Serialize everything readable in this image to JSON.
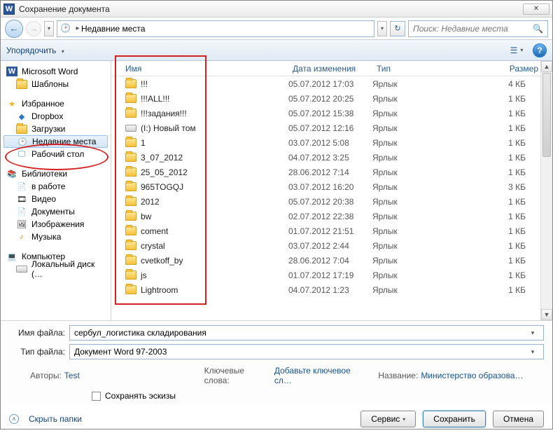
{
  "title": "Сохранение документа",
  "breadcrumb": {
    "current": "Недавние места"
  },
  "search_placeholder": "Поиск: Недавние места",
  "toolbar": {
    "organize": "Упорядочить"
  },
  "sidebar": {
    "word": "Microsoft Word",
    "templates": "Шаблоны",
    "favorites": "Избранное",
    "dropbox": "Dropbox",
    "downloads": "Загрузки",
    "recent": "Недавние места",
    "desktop": "Рабочий стол",
    "libraries": "Библиотеки",
    "inwork": "в работе",
    "video": "Видео",
    "documents": "Документы",
    "pictures": "Изображения",
    "music": "Музыка",
    "computer": "Компьютер",
    "localdisk": "Локальный диск (…"
  },
  "columns": {
    "name": "Имя",
    "date": "Дата изменения",
    "type": "Тип",
    "size": "Размер"
  },
  "files": [
    {
      "name": "!!!",
      "date": "05.07.2012 17:03",
      "type": "Ярлык",
      "size": "4 КБ",
      "kind": "f"
    },
    {
      "name": "!!!ALL!!!",
      "date": "05.07.2012 20:25",
      "type": "Ярлык",
      "size": "1 КБ",
      "kind": "f"
    },
    {
      "name": "!!!задания!!!",
      "date": "05.07.2012 15:38",
      "type": "Ярлык",
      "size": "1 КБ",
      "kind": "f"
    },
    {
      "name": "(I:) Новый том",
      "date": "05.07.2012 12:16",
      "type": "Ярлык",
      "size": "1 КБ",
      "kind": "d"
    },
    {
      "name": "1",
      "date": "03.07.2012 5:08",
      "type": "Ярлык",
      "size": "1 КБ",
      "kind": "f"
    },
    {
      "name": "3_07_2012",
      "date": "04.07.2012 3:25",
      "type": "Ярлык",
      "size": "1 КБ",
      "kind": "f"
    },
    {
      "name": "25_05_2012",
      "date": "28.06.2012 7:14",
      "type": "Ярлык",
      "size": "1 КБ",
      "kind": "f"
    },
    {
      "name": "965TOGQJ",
      "date": "03.07.2012 16:20",
      "type": "Ярлык",
      "size": "3 КБ",
      "kind": "f"
    },
    {
      "name": "2012",
      "date": "05.07.2012 20:38",
      "type": "Ярлык",
      "size": "1 КБ",
      "kind": "f"
    },
    {
      "name": "bw",
      "date": "02.07.2012 22:38",
      "type": "Ярлык",
      "size": "1 КБ",
      "kind": "f"
    },
    {
      "name": "coment",
      "date": "01.07.2012 21:51",
      "type": "Ярлык",
      "size": "1 КБ",
      "kind": "f"
    },
    {
      "name": "crystal",
      "date": "03.07.2012 2:44",
      "type": "Ярлык",
      "size": "1 КБ",
      "kind": "f"
    },
    {
      "name": "cvetkoff_by",
      "date": "28.06.2012 7:04",
      "type": "Ярлык",
      "size": "1 КБ",
      "kind": "f"
    },
    {
      "name": "js",
      "date": "01.07.2012 17:19",
      "type": "Ярлык",
      "size": "1 КБ",
      "kind": "f"
    },
    {
      "name": "Lightroom",
      "date": "04.07.2012 1:23",
      "type": "Ярлык",
      "size": "1 КБ",
      "kind": "f"
    }
  ],
  "filename": {
    "label": "Имя файла:",
    "value": "сербул_логистика складирования"
  },
  "filetype": {
    "label": "Тип файла:",
    "value": "Документ Word 97-2003"
  },
  "meta": {
    "authors_lbl": "Авторы:",
    "authors_val": "Test",
    "keywords_lbl": "Ключевые слова:",
    "keywords_val": "Добавьте ключевое сл…",
    "title_lbl": "Название:",
    "title_val": "Министерство образова…"
  },
  "save_thumbs": "Сохранять эскизы",
  "footer": {
    "hide": "Скрыть папки",
    "tools": "Сервис",
    "save": "Сохранить",
    "cancel": "Отмена"
  }
}
